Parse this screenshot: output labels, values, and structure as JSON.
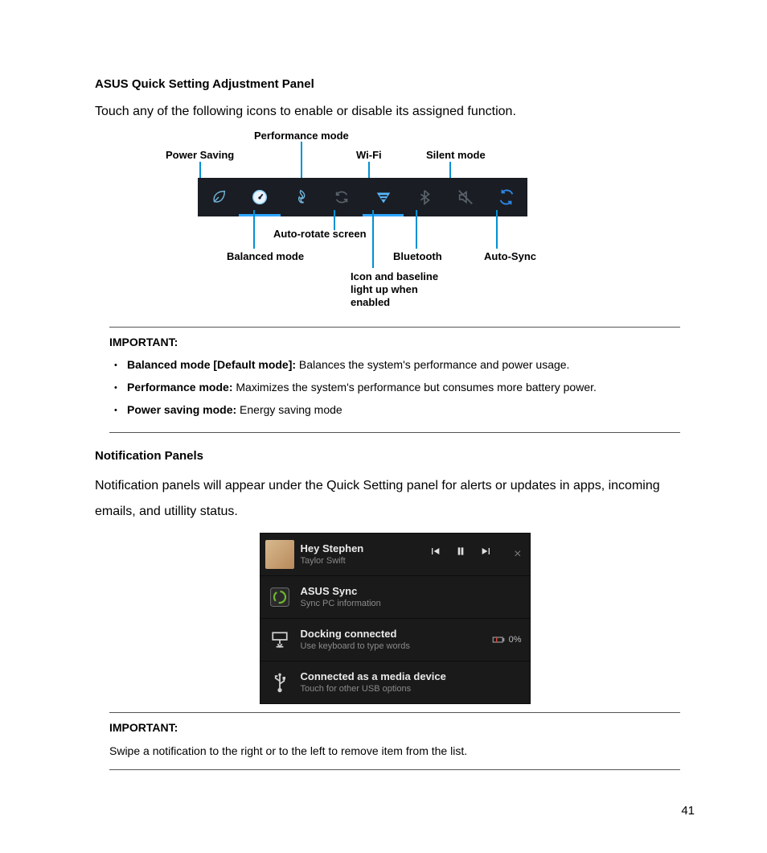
{
  "section1": {
    "title": "ASUS Quick Setting Adjustment Panel",
    "intro": "Touch any of the following icons to enable or disable its assigned function."
  },
  "callouts": {
    "powerSaving": "Power Saving",
    "performance": "Performance mode",
    "wifi": "Wi-Fi",
    "silent": "Silent mode",
    "autoRotate": "Auto-rotate screen",
    "balanced": "Balanced mode",
    "bluetooth": "Bluetooth",
    "autoSync": "Auto-Sync",
    "baselineNote": "Icon and baseline\nlight up when\nenabled"
  },
  "important1": {
    "label": "IMPORTANT:",
    "items": [
      {
        "k": "Balanced mode [Default mode]:",
        "v": " Balances the system's performance and power usage."
      },
      {
        "k": "Performance mode:",
        "v": " Maximizes the system's performance but consumes more battery power."
      },
      {
        "k": "Power saving mode:",
        "v": " Energy saving mode"
      }
    ]
  },
  "section2": {
    "title": "Notification Panels",
    "intro": "Notification panels will appear under the Quick Setting panel for alerts or updates in apps, incoming emails, and utillity status."
  },
  "notifications": [
    {
      "title": "Hey Stephen",
      "sub": "Taylor Swift",
      "type": "music"
    },
    {
      "title": "ASUS Sync",
      "sub": "Sync PC information",
      "type": "sync"
    },
    {
      "title": "Docking connected",
      "sub": "Use keyboard to type words",
      "type": "dock",
      "badge": "0%"
    },
    {
      "title": "Connected as a media device",
      "sub": "Touch for other USB options",
      "type": "usb"
    }
  ],
  "important2": {
    "label": "IMPORTANT:",
    "text": "Swipe a notification to the right or to the left to remove item from the list."
  },
  "page": "41"
}
